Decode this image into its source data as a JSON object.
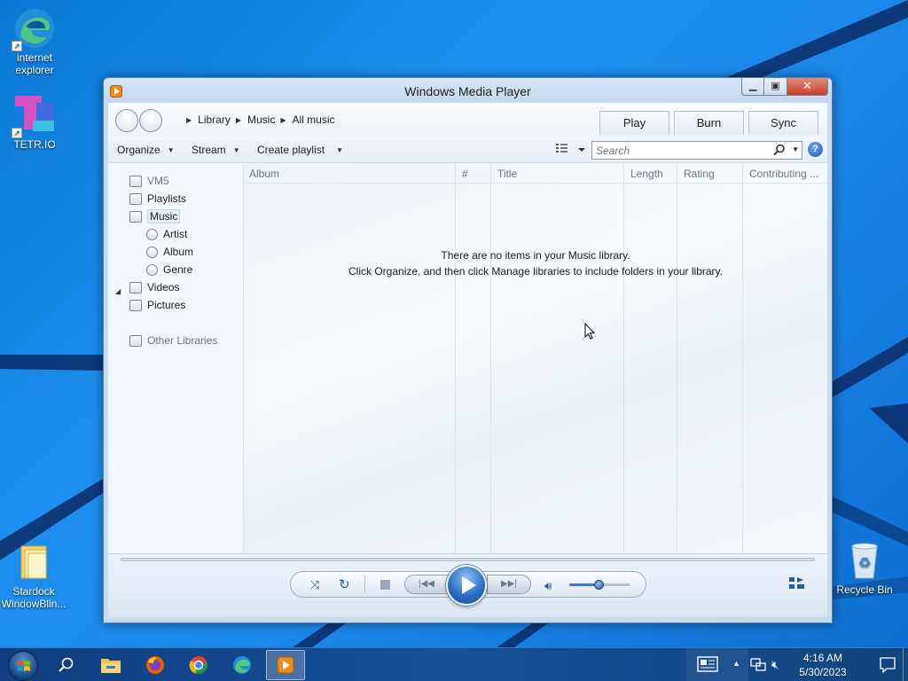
{
  "desktop": {
    "icons": [
      {
        "label_line1": "internet",
        "label_line2": "explorer",
        "icon": "edge-icon"
      },
      {
        "label_line1": "TETR.IO",
        "label_line2": "",
        "icon": "tetrio-icon"
      },
      {
        "label_line1": "Stardock",
        "label_line2": "WindowBlin...",
        "icon": "folder-icon"
      },
      {
        "label_line1": "Recycle Bin",
        "label_line2": "",
        "icon": "recycle-bin-icon"
      }
    ]
  },
  "window": {
    "title": "Windows Media Player",
    "breadcrumb": [
      "Library",
      "Music",
      "All music"
    ],
    "tabs": [
      "Play",
      "Burn",
      "Sync"
    ],
    "toolbar": {
      "organize": "Organize",
      "stream": "Stream",
      "create_playlist": "Create playlist",
      "search_placeholder": "Search",
      "help": "?"
    },
    "nav": {
      "vm": "VM5",
      "playlists": "Playlists",
      "music": "Music",
      "artist": "Artist",
      "album": "Album",
      "genre": "Genre",
      "videos": "Videos",
      "pictures": "Pictures",
      "other_libraries": "Other Libraries"
    },
    "columns": [
      "Album",
      "#",
      "Title",
      "Length",
      "Rating",
      "Contributing ..."
    ],
    "empty_line1": "There are no items in your Music library.",
    "empty_line2": "Click Organize, and then click Manage libraries to include folders in your library.",
    "volume_fraction": 0.5
  },
  "taskbar": {
    "time": "4:16 AM",
    "date": "5/30/2023",
    "pinned": [
      "file-explorer-icon",
      "firefox-icon",
      "chrome-icon",
      "edge-icon",
      "media-player-icon"
    ]
  },
  "colors": {
    "accent": "#2c6fc4",
    "desktop_bg": "#1a86e8",
    "taskbar_bg": "#164f98"
  }
}
